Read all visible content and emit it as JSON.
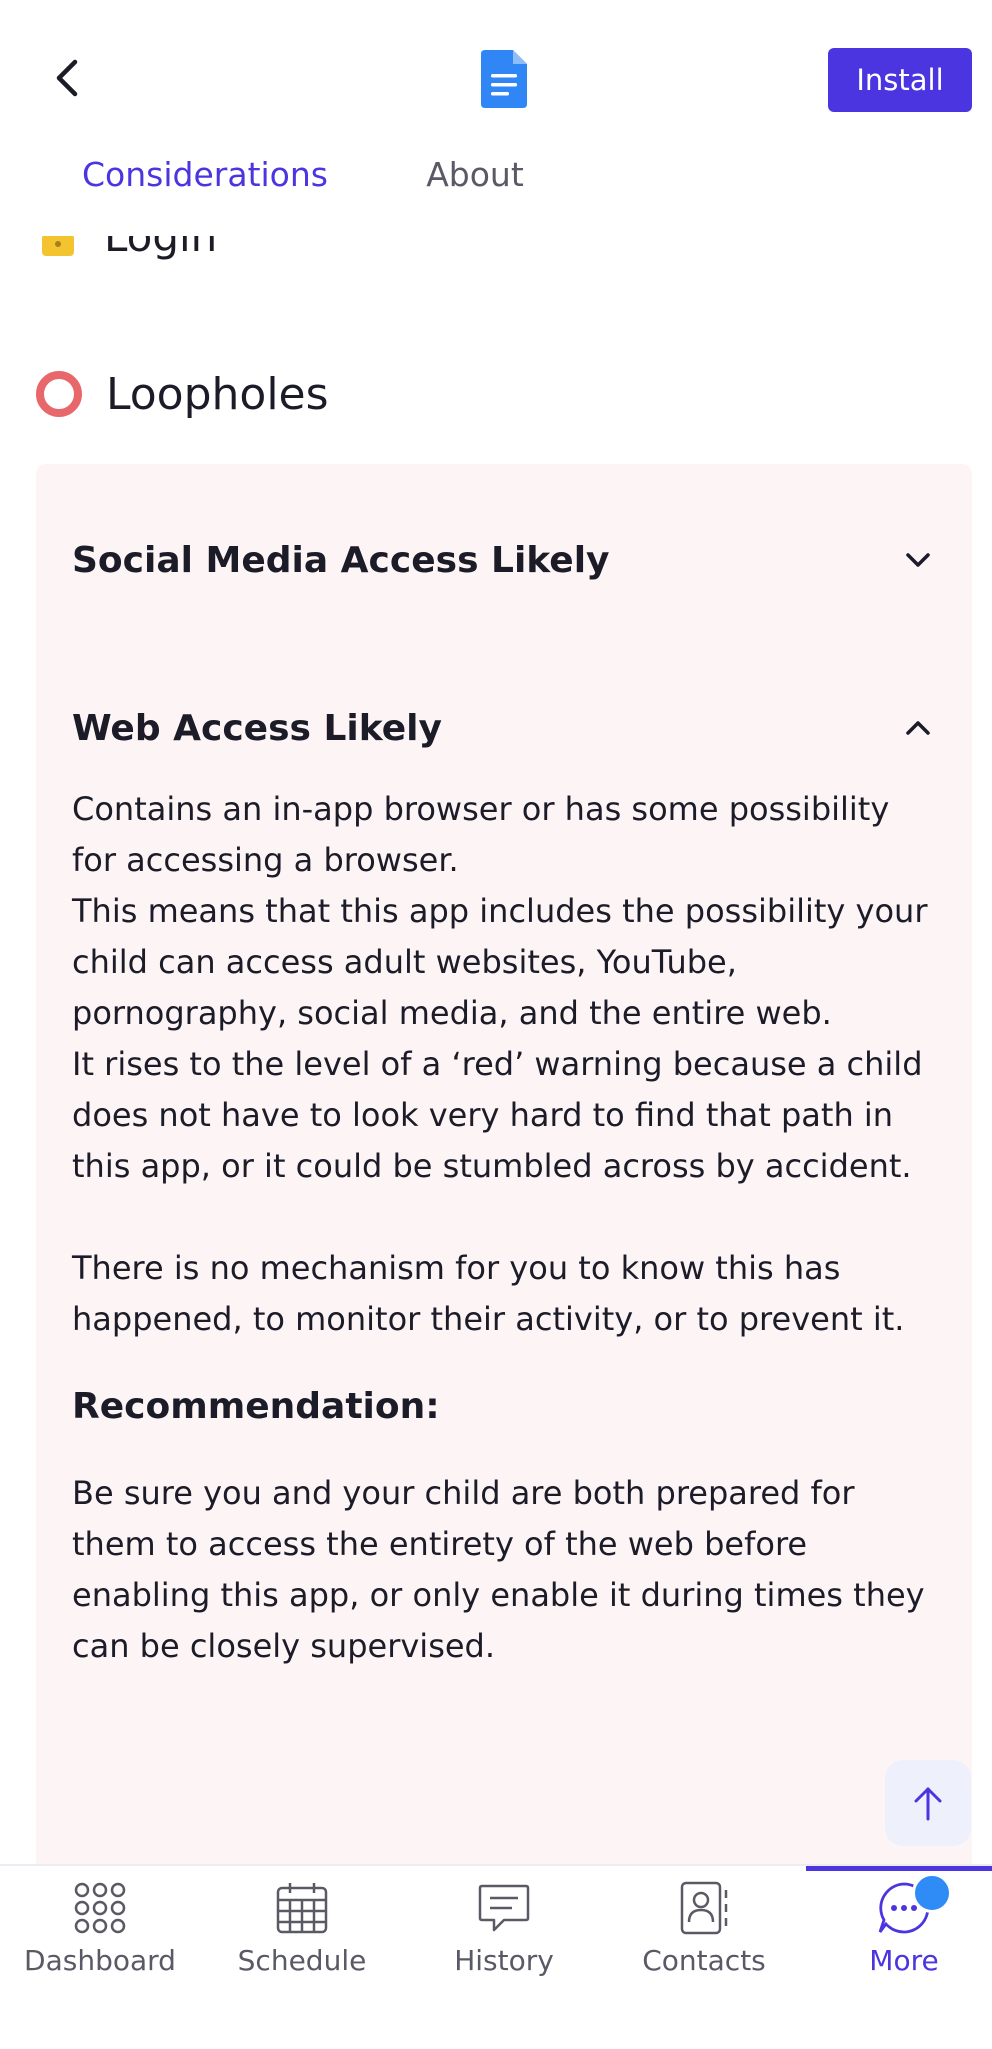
{
  "header": {
    "install_label": "Install"
  },
  "tabs": [
    {
      "label": "Considerations",
      "active": true
    },
    {
      "label": "About",
      "active": false
    }
  ],
  "sections": {
    "login_label": "Login",
    "loopholes_label": "Loopholes"
  },
  "accordion": [
    {
      "title": "Social Media Access Likely",
      "expanded": false
    },
    {
      "title": "Web Access Likely",
      "expanded": true
    }
  ],
  "web_access_body": {
    "p1": "Contains an in-app browser or has some possibility for accessing a browser.",
    "p2": "This means that this app includes the possibility your child can access adult websites, YouTube, pornography, social media, and the entire web.",
    "p3": "It rises to the level of a ‘red’ warning because a child does not have to look very hard to find that path in this app, or it could be stumbled across by accident.",
    "p4": "There is no mechanism for you to know this has happened, to monitor their activity, or to prevent it.",
    "recommendation_title": "Recommendation:",
    "recommendation_text": "Be sure you and your child are both prepared for them to access the entirety of the web before enabling this app, or only enable it during times they can be closely supervised."
  },
  "bottom_nav": [
    {
      "label": "Dashboard",
      "icon": "grid-icon"
    },
    {
      "label": "Schedule",
      "icon": "calendar-icon"
    },
    {
      "label": "History",
      "icon": "message-icon"
    },
    {
      "label": "Contacts",
      "icon": "contacts-icon"
    },
    {
      "label": "More",
      "icon": "more-icon",
      "active": true
    }
  ],
  "colors": {
    "accent": "#4a35e0",
    "card_bg": "#fdf4f6",
    "warning_ring": "#e8676a",
    "badge": "#2f8cf6"
  }
}
